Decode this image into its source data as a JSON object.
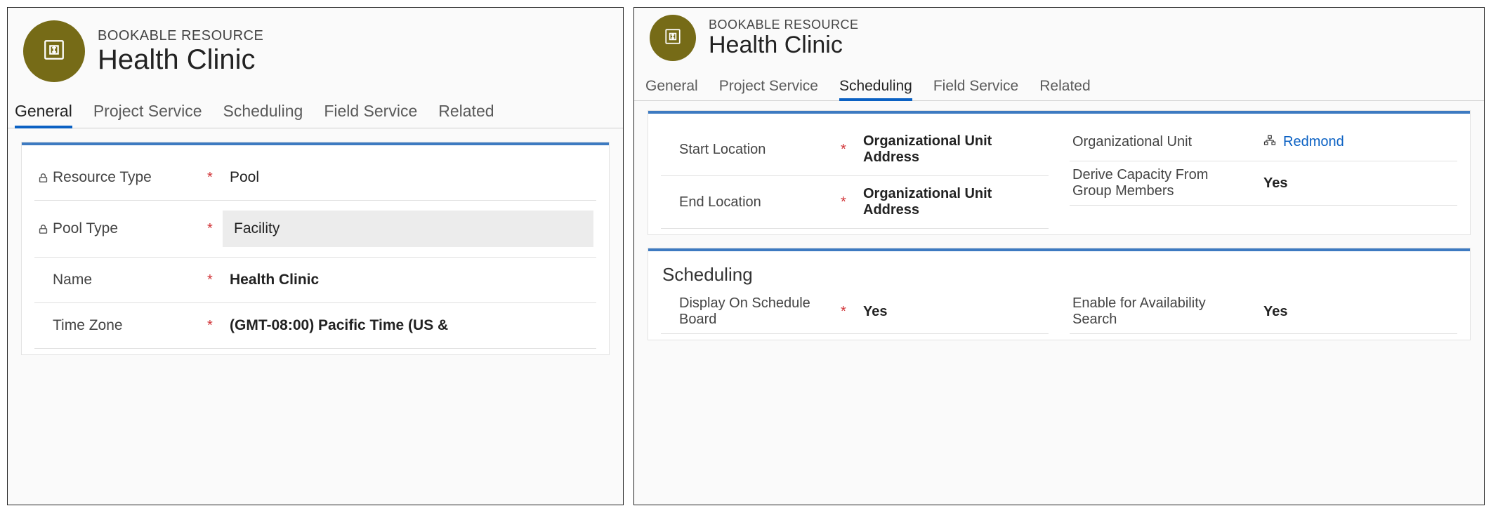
{
  "left": {
    "header": {
      "eyebrow": "BOOKABLE RESOURCE",
      "title": "Health Clinic"
    },
    "tabs": [
      {
        "label": "General",
        "active": true
      },
      {
        "label": "Project Service"
      },
      {
        "label": "Scheduling"
      },
      {
        "label": "Field Service"
      },
      {
        "label": "Related"
      }
    ],
    "fields": {
      "resource_type": {
        "label": "Resource Type",
        "value": "Pool",
        "locked": true,
        "required": true
      },
      "pool_type": {
        "label": "Pool Type",
        "value": "Facility",
        "locked": true,
        "required": true
      },
      "name": {
        "label": "Name",
        "value": "Health Clinic",
        "required": true
      },
      "time_zone": {
        "label": "Time Zone",
        "value": "(GMT-08:00) Pacific Time (US &",
        "required": true
      }
    }
  },
  "right": {
    "header": {
      "eyebrow": "BOOKABLE RESOURCE",
      "title": "Health Clinic"
    },
    "tabs": [
      {
        "label": "General"
      },
      {
        "label": "Project Service"
      },
      {
        "label": "Scheduling",
        "active": true
      },
      {
        "label": "Field Service"
      },
      {
        "label": "Related"
      }
    ],
    "card1": {
      "start_location": {
        "label": "Start Location",
        "value": "Organizational Unit Address",
        "required": true
      },
      "end_location": {
        "label": "End Location",
        "value": "Organizational Unit Address",
        "required": true
      },
      "org_unit": {
        "label": "Organizational Unit",
        "value": "Redmond"
      },
      "derive_capacity": {
        "label": "Derive Capacity From Group Members",
        "value": "Yes"
      }
    },
    "card2": {
      "title": "Scheduling",
      "display_on_board": {
        "label": "Display On Schedule Board",
        "value": "Yes",
        "required": true
      },
      "enable_avail": {
        "label": "Enable for Availability Search",
        "value": "Yes"
      }
    }
  }
}
